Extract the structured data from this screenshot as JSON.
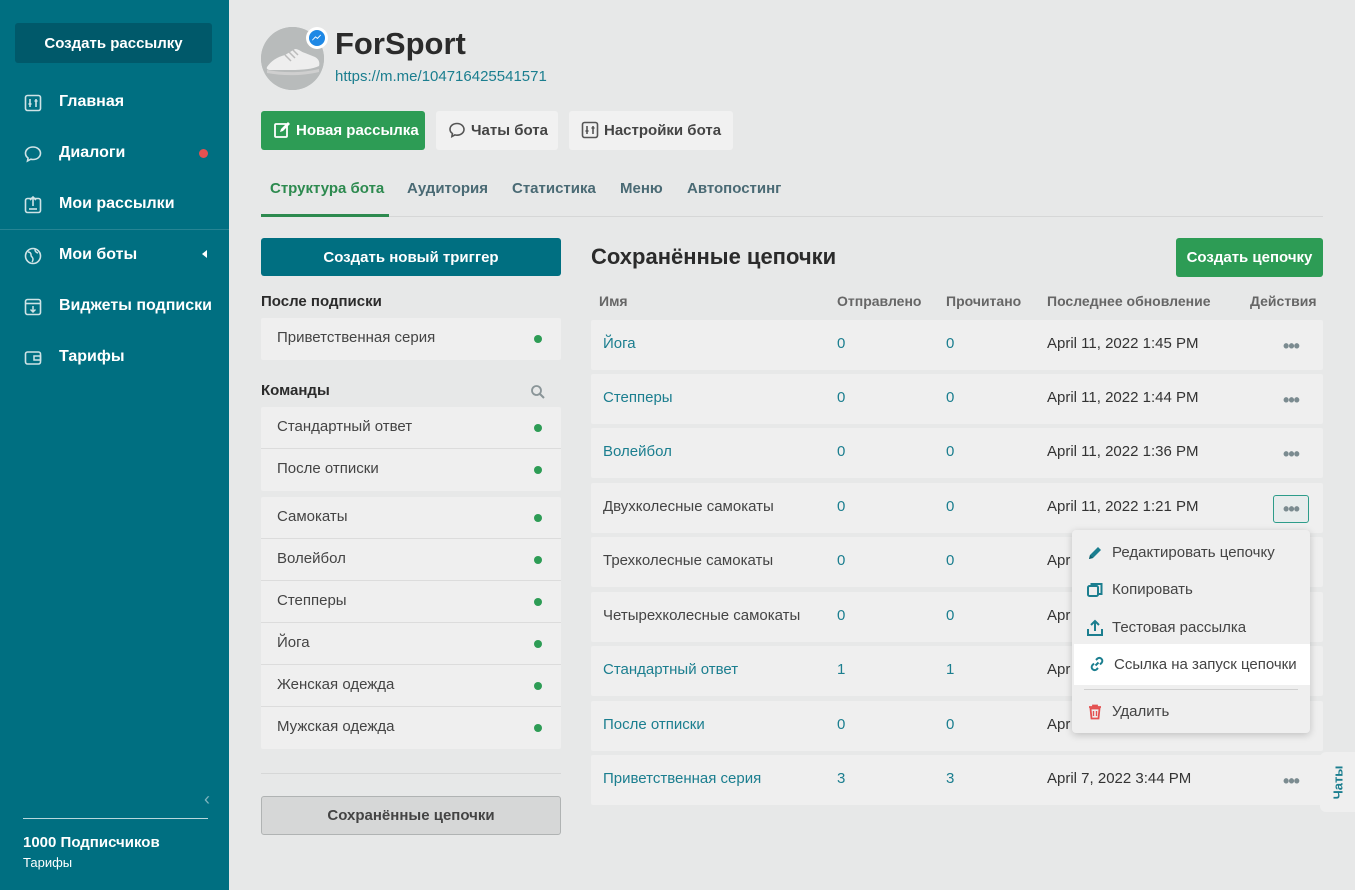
{
  "sidebar": {
    "create_button": "Создать рассылку",
    "items": [
      {
        "label": "Главная",
        "icon": "dashboard-icon"
      },
      {
        "label": "Диалоги",
        "icon": "chat-icon"
      },
      {
        "label": "Мои рассылки",
        "icon": "broadcast-icon"
      },
      {
        "label": "Мои боты",
        "icon": "globe-icon"
      },
      {
        "label": "Виджеты подписки",
        "icon": "widget-icon"
      },
      {
        "label": "Тарифы",
        "icon": "wallet-icon"
      }
    ],
    "subscribers": "1000 Подписчиков",
    "plan": "Тарифы"
  },
  "header": {
    "bot_name": "ForSport",
    "bot_link": "https://m.me/104716425541571",
    "buttons": {
      "new": "Новая рассылка",
      "chats": "Чаты бота",
      "settings": "Настройки бота"
    }
  },
  "tabs": [
    "Структура бота",
    "Аудитория",
    "Статистика",
    "Меню",
    "Автопостинг"
  ],
  "left": {
    "create_trigger": "Создать новый триггер",
    "after_subscribe_title": "После подписки",
    "after_subscribe": [
      "Приветственная серия"
    ],
    "commands_title": "Команды",
    "commands": [
      "Стандартный ответ",
      "После отписки"
    ],
    "triggers": [
      "Самокаты",
      "Волейбол",
      "Степперы",
      "Йога",
      "Женская одежда",
      "Мужская одежда"
    ],
    "saved_button": "Сохранённые цепочки"
  },
  "chains": {
    "title": "Сохранённые цепочки",
    "create_button": "Создать цепочку",
    "columns": {
      "name": "Имя",
      "sent": "Отправлено",
      "read": "Прочитано",
      "updated": "Последнее обновление",
      "actions": "Действия"
    },
    "rows": [
      {
        "name": "Йога",
        "sent": "0",
        "read": "0",
        "date": "April 11, 2022 1:45 PM"
      },
      {
        "name": "Степперы",
        "sent": "0",
        "read": "0",
        "date": "April 11, 2022 1:44 PM"
      },
      {
        "name": "Волейбол",
        "sent": "0",
        "read": "0",
        "date": "April 11, 2022 1:36 PM"
      },
      {
        "name": "Двухколесные самокаты",
        "sent": "0",
        "read": "0",
        "date": "April 11, 2022 1:21 PM"
      },
      {
        "name": "Трехколесные самокаты",
        "sent": "0",
        "read": "0",
        "date": "Apr"
      },
      {
        "name": "Четырехколесные самокаты",
        "sent": "0",
        "read": "0",
        "date": "Apr"
      },
      {
        "name": "Стандартный ответ",
        "sent": "1",
        "read": "1",
        "date": "Apr"
      },
      {
        "name": "После отписки",
        "sent": "0",
        "read": "0",
        "date": "Apr"
      },
      {
        "name": "Приветственная серия",
        "sent": "3",
        "read": "3",
        "date": "April 7, 2022 3:44 PM"
      }
    ],
    "dots": "•••"
  },
  "menu": {
    "edit": "Редактировать цепочку",
    "copy": "Копировать",
    "test": "Тестовая рассылка",
    "link": "Ссылка на запуск цепочки",
    "delete": "Удалить"
  },
  "chats_tab": "Чаты",
  "colors": {
    "teal": "#006f81",
    "green": "#2d9c55",
    "link": "#1b7e8f",
    "red": "#e45151"
  }
}
